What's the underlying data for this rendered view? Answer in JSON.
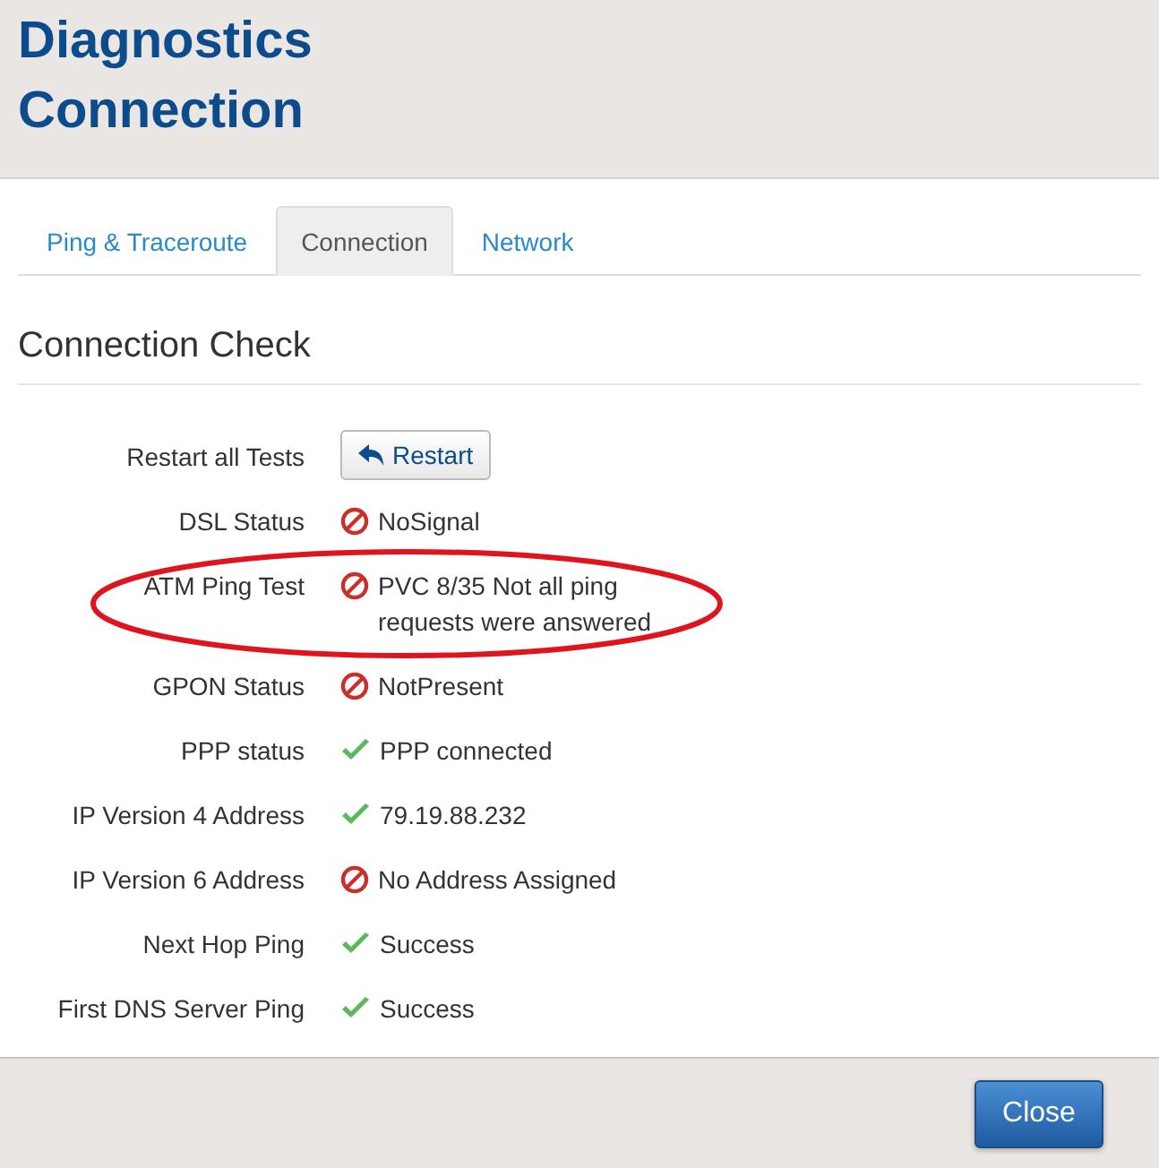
{
  "title_lines": [
    "Diagnostics",
    "Connection"
  ],
  "tabs": [
    {
      "label": "Ping & Traceroute",
      "selected": false
    },
    {
      "label": "Connection",
      "selected": true
    },
    {
      "label": "Network",
      "selected": false
    }
  ],
  "heading": "Connection Check",
  "restart": {
    "label": "Restart all Tests",
    "button": "Restart"
  },
  "rows": [
    {
      "label": "DSL Status",
      "passed": false,
      "value": "NoSignal",
      "highlighted": false
    },
    {
      "label": "ATM Ping Test",
      "passed": false,
      "value": "PVC 8/35 Not all ping requests were answered",
      "highlighted": true
    },
    {
      "label": "GPON Status",
      "passed": false,
      "value": "NotPresent",
      "highlighted": false
    },
    {
      "label": "PPP status",
      "passed": true,
      "value": "PPP connected",
      "highlighted": false
    },
    {
      "label": "IP Version 4 Address",
      "passed": true,
      "value": "79.19.88.232",
      "highlighted": false
    },
    {
      "label": "IP Version 6 Address",
      "passed": false,
      "value": "No Address Assigned",
      "highlighted": false
    },
    {
      "label": "Next Hop Ping",
      "passed": true,
      "value": "Success",
      "highlighted": false
    },
    {
      "label": "First DNS Server Ping",
      "passed": true,
      "value": "Success",
      "highlighted": false
    }
  ],
  "close_button": "Close"
}
